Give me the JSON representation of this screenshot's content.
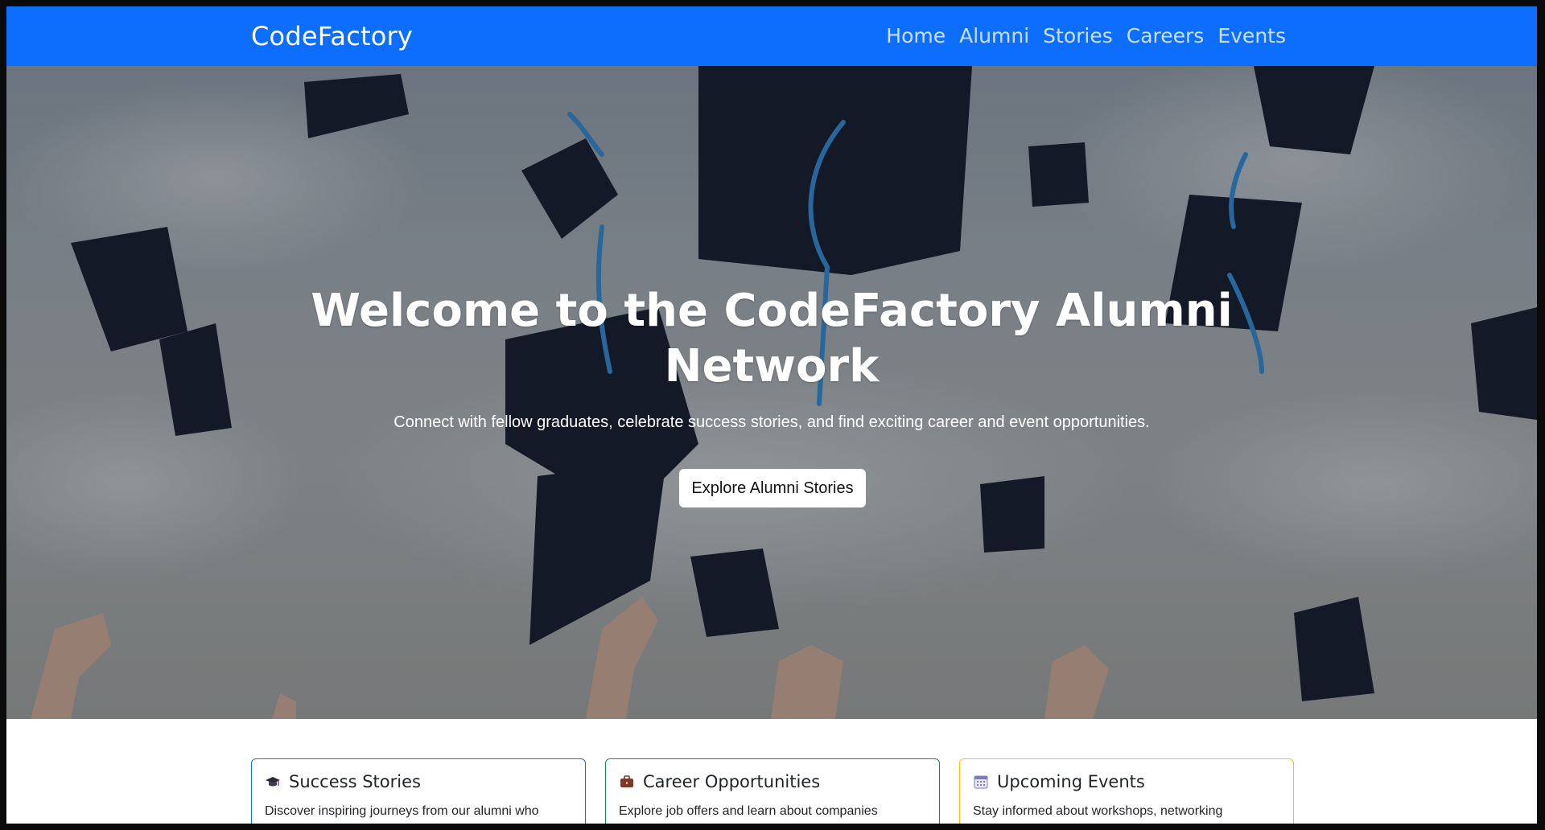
{
  "navbar": {
    "brand": "CodeFactory",
    "links": [
      "Home",
      "Alumni",
      "Stories",
      "Careers",
      "Events"
    ]
  },
  "hero": {
    "title": "Welcome to the CodeFactory Alumni Network",
    "subtitle": "Connect with fellow graduates, celebrate success stories, and find exciting career and event opportunities.",
    "button_label": "Explore Alumni Stories",
    "image_alt": "graduation caps thrown in the air"
  },
  "cards": [
    {
      "title": "Success Stories",
      "icon": "graduation-cap-icon",
      "text": "Discover inspiring journeys from our alumni who",
      "border_color": "#0d6efd"
    },
    {
      "title": "Career Opportunities",
      "icon": "briefcase-icon",
      "text": "Explore job offers and learn about companies",
      "border_color": "#198754"
    },
    {
      "title": "Upcoming Events",
      "icon": "calendar-icon",
      "text": "Stay informed about workshops, networking",
      "border_color": "#ffc107"
    }
  ],
  "colors": {
    "primary": "#0d6efd",
    "success": "#198754",
    "warning": "#ffc107"
  }
}
